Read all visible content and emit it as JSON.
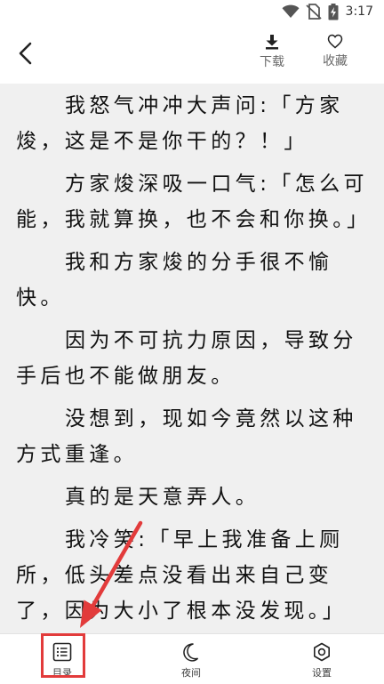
{
  "status_bar": {
    "time": "3:17",
    "icons": [
      "wifi-icon",
      "no-sim-icon",
      "battery-charging-icon"
    ]
  },
  "header": {
    "back_icon": "chevron-left-icon",
    "download_label": "下载",
    "favorite_label": "收藏"
  },
  "content": {
    "paragraphs": [
      "我怒气冲冲大声问:「方家焌，这是不是你干的？！」",
      "方家焌深吸一口气:「怎么可能，我就算换，也不会和你换。」",
      "我和方家焌的分手很不愉快。",
      "因为不可抗力原因，导致分手后也不能做朋友。",
      "没想到，现如今竟然以这种方式重逢。",
      "真的是天意弄人。",
      "我冷笑:「早上我准备上厕所，低头差点没看出来自己变了，因为大小了根本没发现。」"
    ]
  },
  "bottom_bar": {
    "toc_label": "目录",
    "night_label": "夜间",
    "settings_label": "设置"
  },
  "annotation": {
    "color": "#e23b3b"
  }
}
